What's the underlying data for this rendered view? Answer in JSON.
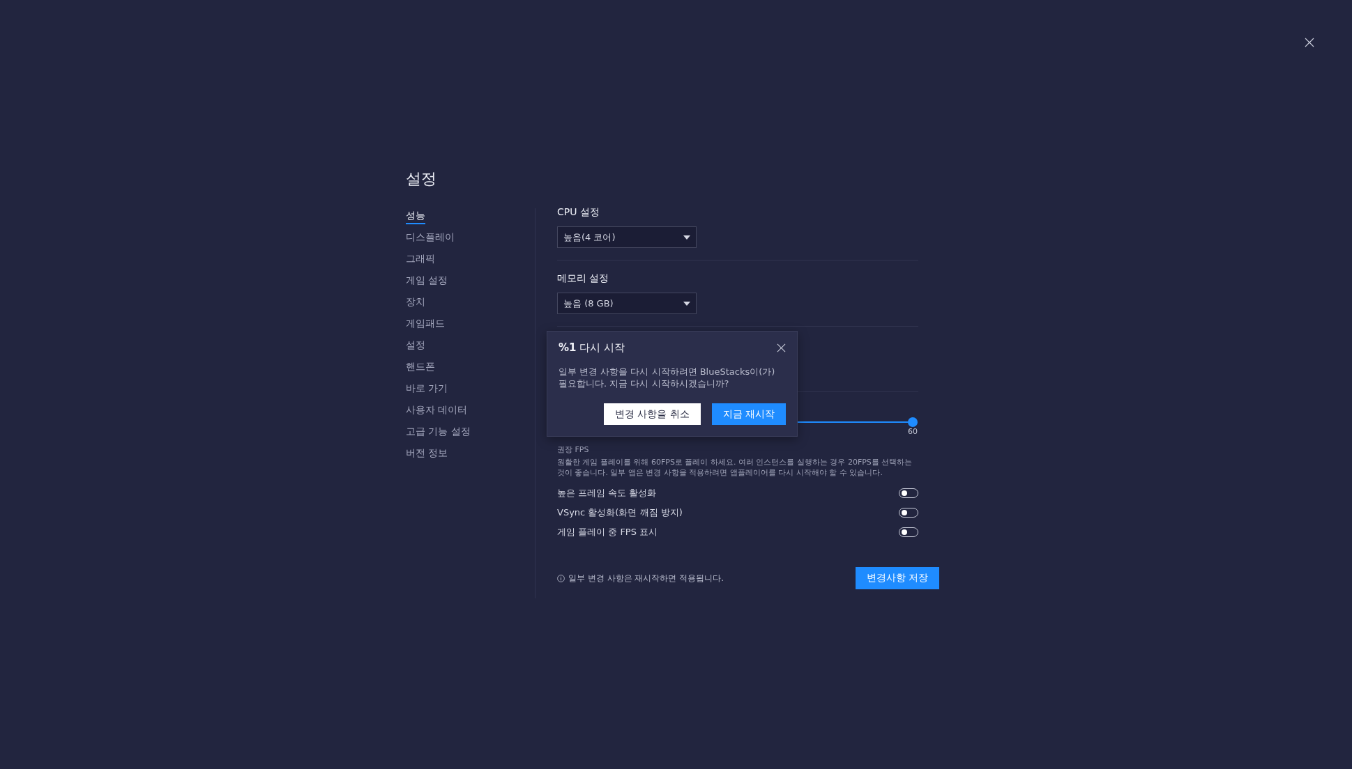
{
  "title": "설정",
  "sidebar": [
    {
      "label": "성능",
      "selected": true
    },
    {
      "label": "디스플레이",
      "selected": false
    },
    {
      "label": "그래픽",
      "selected": false
    },
    {
      "label": "게임 설정",
      "selected": false
    },
    {
      "label": "장치",
      "selected": false
    },
    {
      "label": "게임패드",
      "selected": false
    },
    {
      "label": "설정",
      "selected": false
    },
    {
      "label": "핸드폰",
      "selected": false
    },
    {
      "label": "바로 가기",
      "selected": false
    },
    {
      "label": "사용자 데이터",
      "selected": false
    },
    {
      "label": "고급 기능 설정",
      "selected": false
    },
    {
      "label": "버전 정보",
      "selected": false
    }
  ],
  "sections": [
    {
      "label": "CPU 설정",
      "dropdown": "높음(4 코어)"
    },
    {
      "label": "메모리 설정",
      "dropdown": "높음 (8 GB)"
    }
  ],
  "fps": {
    "level": 1,
    "reading": "60",
    "heading": "권장 FPS",
    "description": "원활한 게임 플레이를 위해 60FPS로 플레이 하세요. 여러 인스턴스를 실행하는 경우 20FPS를 선택하는 것이 좋습니다. 일부 앱은 변경 사항을 적용하려면 앱플레이어를 다시 시작해야 할 수 있습니다."
  },
  "toggles": [
    {
      "label": "높은 프레임 속도 활성화",
      "on": false
    },
    {
      "label": "VSync 활성화(화면 깨짐 방지)",
      "on": false
    },
    {
      "label": "게임 플레이 중 FPS 표시",
      "on": false
    }
  ],
  "footer": {
    "note": "일부 변경 사항은 재시작하면 적용됩니다.",
    "save_button": "변경사항 저장"
  },
  "dialog": {
    "title": "**%1** 다시 시작",
    "message": "일부 변경 사항을 다시 시작하려면 BlueStacks이(가) 필요합니다. 지금 다시 시작하시겠습니까?",
    "buttons": [
      {
        "label": "변경 사항을 취소",
        "kind": "secondary"
      },
      {
        "label": "지금 재시작",
        "kind": "primary"
      }
    ]
  }
}
